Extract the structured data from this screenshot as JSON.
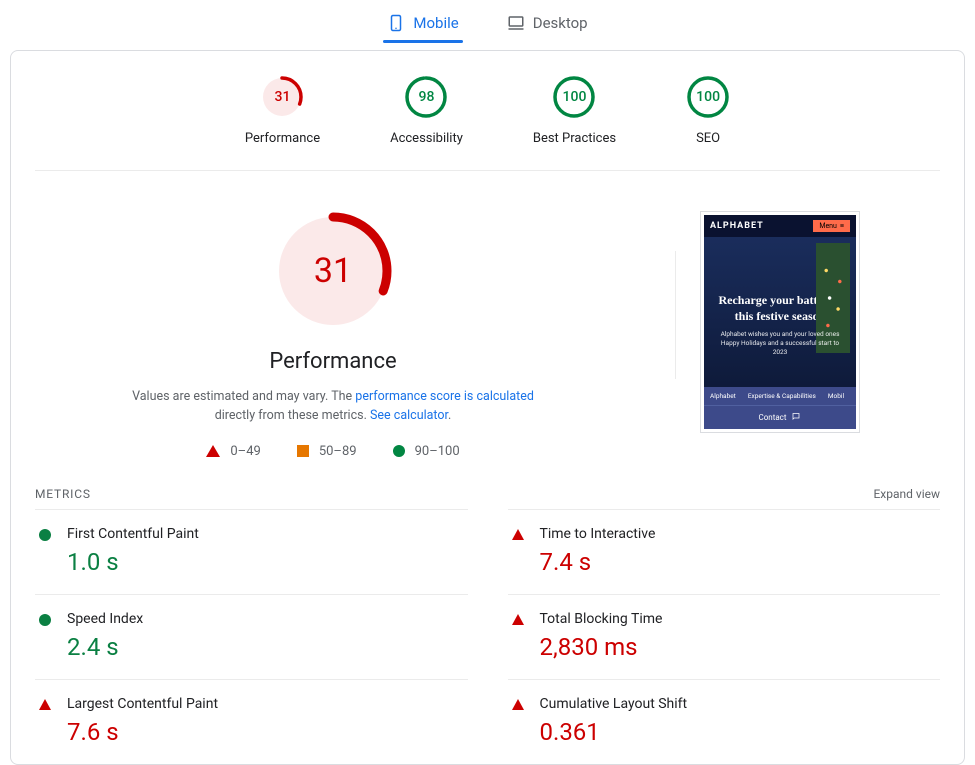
{
  "tabs": {
    "mobile": "Mobile",
    "desktop": "Desktop",
    "active": "mobile"
  },
  "gauges": [
    {
      "score": 31,
      "label": "Performance",
      "color": "#cc0000",
      "bg": "#fbe9e9",
      "ratio": 0.31
    },
    {
      "score": 98,
      "label": "Accessibility",
      "color": "#018642",
      "bg": "#ffffff",
      "ratio": 0.98
    },
    {
      "score": 100,
      "label": "Best Practices",
      "color": "#018642",
      "bg": "#ffffff",
      "ratio": 1.0
    },
    {
      "score": 100,
      "label": "SEO",
      "color": "#018642",
      "bg": "#ffffff",
      "ratio": 1.0
    }
  ],
  "hero": {
    "score": 31,
    "title": "Performance",
    "disclaimer_pre": "Values are estimated and may vary. The ",
    "disclaimer_link1": "performance score is calculated",
    "disclaimer_mid": " directly from these metrics. ",
    "disclaimer_link2": "See calculator",
    "disclaimer_post": "."
  },
  "legend": {
    "red": "0–49",
    "orange": "50–89",
    "green": "90–100"
  },
  "preview": {
    "brand": "ALPHABET",
    "menu": "Menu",
    "headline": "Recharge your batteries this festive season",
    "sub": "Alphabet wishes you and your loved ones Happy Holidays and a successful start to 2023",
    "nav": [
      "Alphabet",
      "Expertise & Capabilities",
      "Mobil"
    ],
    "contact": "Contact"
  },
  "metrics": {
    "title": "METRICS",
    "expand": "Expand view",
    "left": [
      {
        "name": "First Contentful Paint",
        "value": "1.0 s",
        "status": "green"
      },
      {
        "name": "Speed Index",
        "value": "2.4 s",
        "status": "green"
      },
      {
        "name": "Largest Contentful Paint",
        "value": "7.6 s",
        "status": "red"
      }
    ],
    "right": [
      {
        "name": "Time to Interactive",
        "value": "7.4 s",
        "status": "red"
      },
      {
        "name": "Total Blocking Time",
        "value": "2,830 ms",
        "status": "red"
      },
      {
        "name": "Cumulative Layout Shift",
        "value": "0.361",
        "status": "red"
      }
    ]
  }
}
